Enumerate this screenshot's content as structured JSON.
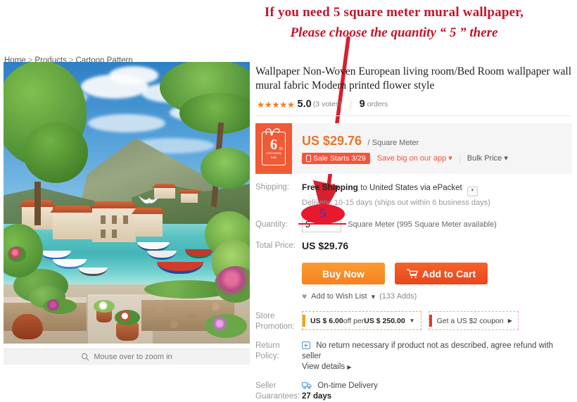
{
  "annotation": {
    "line1": "If you need  5  square meter mural wallpaper,",
    "line2": "Please choose the quantity “ 5 ”  there",
    "arrow_color": "#d6202f",
    "ellipse_value": "5",
    "ellipse_fill": "#e8192c",
    "ellipse_text_color": "#5b2fb0"
  },
  "breadcrumb": {
    "home": "Home",
    "sep": ">",
    "products": "Products",
    "category": "Cartoon Pattern"
  },
  "gallery": {
    "zoom_hint": "Mouse over to zoom in",
    "zoom_icon": "search-icon",
    "alt": "Mediterranean seaside village mural with boats and flowers"
  },
  "product": {
    "title": "Wallpaper Non-Woven European living room/Bed Room wallpaper wall mural fabric Modern printed flower style",
    "stars": "★★★★★",
    "score": "5.0",
    "votes": "(3 votes)",
    "orders_count": "9",
    "orders_label": "orders"
  },
  "price_panel": {
    "badge": {
      "number": "6",
      "ordinal": "th",
      "line1": "Anniversary",
      "line2": "Sale",
      "color": "#f05a35"
    },
    "price": "US $29.76",
    "unit": "/ Square Meter",
    "sale_badge": "Sale Starts 3/29",
    "sale_badge_icon": "mobile-icon",
    "app_save": "Save big on our app",
    "bulk_price": "Bulk Price",
    "price_color": "#e4762b"
  },
  "shipping": {
    "label": "Shipping:",
    "free": "Free Shipping",
    "to": "to",
    "destination": "United States via ePacket",
    "dropdown_icon": "chevron-down-icon",
    "delivery": "Delivery: 10-15 days (ships out within 6 business days)"
  },
  "quantity": {
    "label": "Quantity:",
    "value": "5",
    "unit_available": "Square Meter (995 Square Meter available)"
  },
  "total": {
    "label": "Total Price:",
    "value": "US $29.76"
  },
  "actions": {
    "buy_now": "Buy Now",
    "add_to_cart": "Add to Cart",
    "cart_icon": "shopping-cart-icon",
    "wish_icon": "heart-icon",
    "wish_label": "Add to Wish List",
    "wish_caret": "chevron-down-icon",
    "wish_count": "(133 Adds)"
  },
  "store_promotion": {
    "label_line1": "Store",
    "label_line2": "Promotion:",
    "promo1_strong": "US $ 6.00",
    "promo1_mid": " off per ",
    "promo1_strong2": "US $ 250.00",
    "promo1_caret": "▼",
    "promo2": "Get a US $2 coupon",
    "promo2_caret": "▶"
  },
  "return_policy": {
    "label_line1": "Return",
    "label_line2": "Policy:",
    "icon": "return-box-icon",
    "text": "No return necessary if product not as described, agree refund with seller",
    "view_details": "View details",
    "view_caret": "▶"
  },
  "seller_guarantees": {
    "label_line1": "Seller",
    "label_line2": "Guarantees:",
    "icon": "delivery-truck-icon",
    "text": "On-time Delivery",
    "days": "27 days"
  }
}
